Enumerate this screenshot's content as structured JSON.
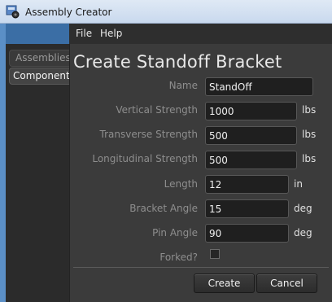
{
  "window": {
    "title": "Assembly Creator"
  },
  "menubar": {
    "items": [
      "File",
      "Help"
    ]
  },
  "nav": {
    "tabs": [
      "Assemblies",
      "Components"
    ],
    "selected": "Components"
  },
  "form": {
    "title": "Create Standoff Bracket",
    "fields": [
      {
        "label": "Name",
        "value": "StandOff",
        "unit": ""
      },
      {
        "label": "Vertical Strength",
        "value": "1000",
        "unit": "lbs"
      },
      {
        "label": "Transverse Strength",
        "value": "500",
        "unit": "lbs"
      },
      {
        "label": "Longitudinal Strength",
        "value": "500",
        "unit": "lbs"
      },
      {
        "label": "Length",
        "value": "12",
        "unit": "in"
      },
      {
        "label": "Bracket Angle",
        "value": "15",
        "unit": "deg"
      },
      {
        "label": "Pin Angle",
        "value": "90",
        "unit": "deg"
      }
    ],
    "forked": {
      "label": "Forked?",
      "checked": false
    }
  },
  "buttons": {
    "create": "Create",
    "cancel": "Cancel"
  }
}
